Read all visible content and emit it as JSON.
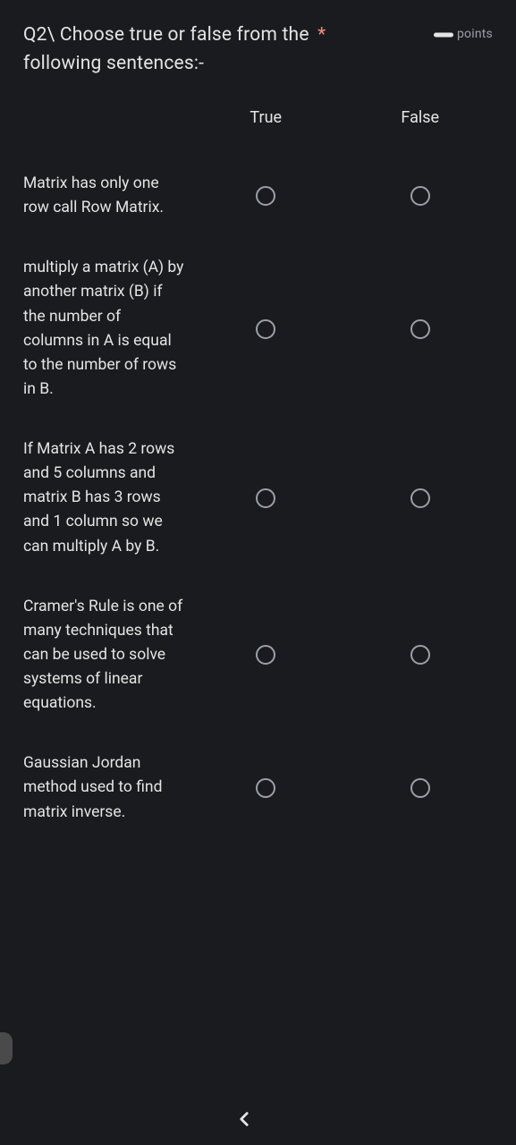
{
  "question": {
    "title_prefix": "Q2\\ Choose true or false from the",
    "title_suffix": "following sentences:-",
    "required_mark": "*",
    "points_text": "points"
  },
  "columns": {
    "true": "True",
    "false": "False"
  },
  "rows": [
    {
      "label": "Matrix has only one row call Row Matrix."
    },
    {
      "label": "multiply a matrix (A) by another matrix (B) if the number of columns in A is equal to the number of rows in B."
    },
    {
      "label": "If Matrix A has 2 rows and 5 columns and matrix B has 3 rows and 1 column so we can multiply A by B."
    },
    {
      "label": "Cramer's Rule is one of many techniques that can be used to solve systems of linear equations."
    },
    {
      "label": "Gaussian Jordan method used to find matrix inverse."
    }
  ],
  "nav": {
    "chevron": "›"
  }
}
